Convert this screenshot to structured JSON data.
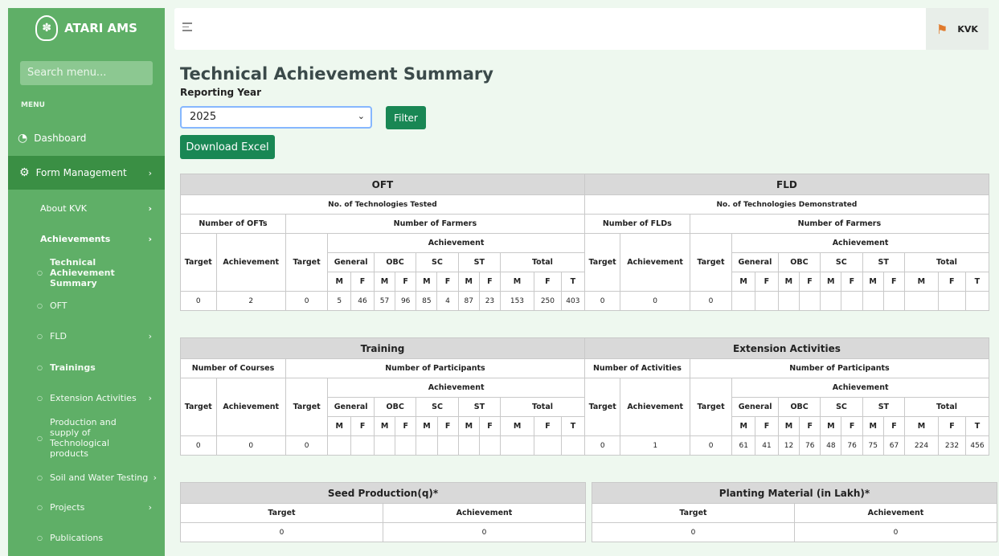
{
  "sidebar": {
    "brand": "ATARI AMS",
    "search_placeholder": "Search menu...",
    "menu_heading": "MENU",
    "dashboard": "Dashboard",
    "form_management": "Form Management",
    "about_kvk": "About KVK",
    "achievements": "Achievements",
    "technical_summary": "Technical Achievement Summary",
    "oft": "OFT",
    "fld": "FLD",
    "trainings": "Trainings",
    "extension": "Extension Activities",
    "production": "Production and supply of Technological products",
    "soil": "Soil and Water Testing",
    "projects": "Projects",
    "publications": "Publications"
  },
  "topbar": {
    "user": "KVK"
  },
  "page": {
    "title": "Technical Achievement Summary",
    "year_label": "Reporting Year",
    "year_value": "2025",
    "filter": "Filter",
    "download": "Download Excel"
  },
  "labels": {
    "target": "Target",
    "achievement": "Achievement",
    "general": "General",
    "obc": "OBC",
    "sc": "SC",
    "st": "ST",
    "total": "Total",
    "m": "M",
    "f": "F",
    "t": "T"
  },
  "oft": {
    "title": "OFT",
    "subtitle": "No. of Technologies Tested",
    "left": "Number of OFTs",
    "right": "Number of Farmers",
    "row": [
      "0",
      "2",
      "0",
      "5",
      "46",
      "57",
      "96",
      "85",
      "4",
      "87",
      "23",
      "153",
      "250",
      "403"
    ]
  },
  "fld": {
    "title": "FLD",
    "subtitle": "No. of Technologies Demonstrated",
    "left": "Number of FLDs",
    "right": "Number of Farmers",
    "row": [
      "0",
      "0",
      "0",
      "",
      "",
      "",
      "",
      "",
      "",
      "",
      "",
      "",
      "",
      ""
    ]
  },
  "training": {
    "title": "Training",
    "left": "Number of Courses",
    "right": "Number of Participants",
    "row": [
      "0",
      "0",
      "0",
      "",
      "",
      "",
      "",
      "",
      "",
      "",
      "",
      "",
      "",
      ""
    ]
  },
  "extension": {
    "title": "Extension Activities",
    "left": "Number of Activities",
    "right": "Number of Participants",
    "row": [
      "0",
      "1",
      "0",
      "61",
      "41",
      "12",
      "76",
      "48",
      "76",
      "75",
      "67",
      "224",
      "232",
      "456"
    ]
  },
  "seed": {
    "title": "Seed Production(q)*",
    "target": "0",
    "achievement": "0"
  },
  "planting": {
    "title": "Planting Material (in Lakh)*",
    "target": "0",
    "achievement": "0"
  }
}
